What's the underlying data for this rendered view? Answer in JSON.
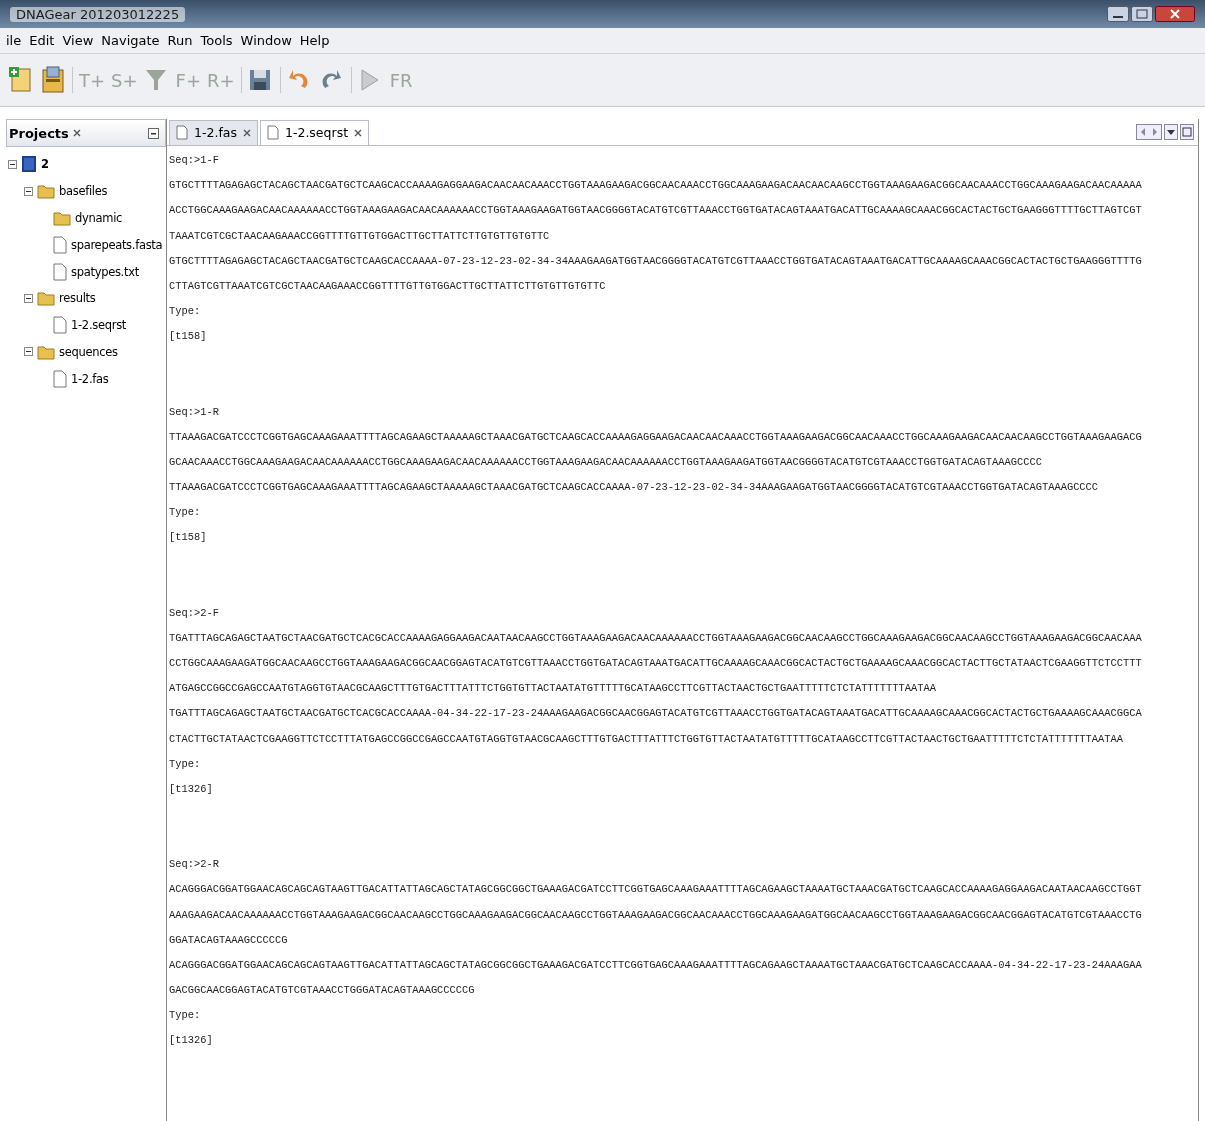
{
  "window": {
    "title": "DNAGear 201203012225"
  },
  "menu": [
    "ile",
    "Edit",
    "View",
    "Navigate",
    "Run",
    "Tools",
    "Window",
    "Help"
  ],
  "toolbar": [
    {
      "kind": "new"
    },
    {
      "kind": "open"
    },
    {
      "kind": "text",
      "label": "T+"
    },
    {
      "kind": "text",
      "label": "S+"
    },
    {
      "kind": "filter"
    },
    {
      "kind": "text",
      "label": "F+"
    },
    {
      "kind": "text",
      "label": "R+"
    },
    {
      "kind": "save"
    },
    {
      "kind": "undo"
    },
    {
      "kind": "redo"
    },
    {
      "kind": "run"
    },
    {
      "kind": "text",
      "label": "FR"
    }
  ],
  "projects": {
    "title": "Projects",
    "tree": [
      {
        "label": "2",
        "kind": "project",
        "expanded": true,
        "children": [
          {
            "label": "basefiles",
            "kind": "folder",
            "expanded": true,
            "children": [
              {
                "label": "dynamic",
                "kind": "folder"
              },
              {
                "label": "sparepeats.fasta",
                "kind": "file"
              },
              {
                "label": "spatypes.txt",
                "kind": "file"
              }
            ]
          },
          {
            "label": "results",
            "kind": "folder",
            "expanded": true,
            "children": [
              {
                "label": "1-2.seqrst",
                "kind": "file"
              }
            ]
          },
          {
            "label": "sequences",
            "kind": "folder",
            "expanded": true,
            "children": [
              {
                "label": "1-2.fas",
                "kind": "file"
              }
            ]
          }
        ]
      }
    ]
  },
  "editor": {
    "tabs": [
      {
        "label": "1-2.fas",
        "selected": false
      },
      {
        "label": "1-2.seqrst",
        "selected": true
      }
    ],
    "records": [
      {
        "header": "Seq:>1-F",
        "sequence_lines": [
          "GTGCTTTTAGAGAGCTACAGCTAACGATGCTCAAGCACCAAAAGAGGAAGACAACAACAAACCTGGTAAAGAAGACGGCAACAAACCTGGCAAAGAAGACAACAACAAGCCTGGTAAAGAAGACGGCAACAAACCTGGCAAAGAAGACAACAAAAA",
          "ACCTGGCAAAGAAGACAACAAAAAACCTGGTAAAGAAGACAACAAAAAACCTGGTAAAGAAGATGGTAACGGGGTACATGTCGTTAAACCTGGTGATACAGTAAATGACATTGCAAAAGCAAACGGCACTACTGCTGAAGGGTTTTGCTTAGTCGT",
          "TAAATCGTCGCTAACAAGAAACCGGTTTTGTTGTGGACTTGCTTATTCTTGTGTTGTGTTC",
          "GTGCTTTTAGAGAGCTACAGCTAACGATGCTCAAGCACCAAAA-07-23-12-23-02-34-34AAAGAAGATGGTAACGGGGTACATGTCGTTAAACCTGGTGATACAGTAAATGACATTGCAAAAGCAAACGGCACTACTGCTGAAGGGTTTTG",
          "CTTAGTCGTTAAATCGTCGCTAACAAGAAACCGGTTTTGTTGTGGACTTGCTTATTCTTGTGTTGTGTTC"
        ],
        "type_label": "Type:",
        "type_value": "[t158]"
      },
      {
        "header": "Seq:>1-R",
        "sequence_lines": [
          "TTAAAGACGATCCCTCGGTGAGCAAAGAAATTTTAGCAGAAGCTAAAAAGCTAAACGATGCTCAAGCACCAAAAGAGGAAGACAACAACAAACCTGGTAAAGAAGACGGCAACAAACCTGGCAAAGAAGACAACAACAAGCCTGGTAAAGAAGACG",
          "GCAACAAACCTGGCAAAGAAGACAACAAAAAACCTGGCAAAGAAGACAACAAAAAACCTGGTAAAGAAGACAACAAAAAACCTGGTAAAGAAGATGGTAACGGGGTACATGTCGTAAACCTGGTGATACAGTAAAGCCCC",
          "TTAAAGACGATCCCTCGGTGAGCAAAGAAATTTTAGCAGAAGCTAAAAAGCTAAACGATGCTCAAGCACCAAAA-07-23-12-23-02-34-34AAAGAAGATGGTAACGGGGTACATGTCGTAAACCTGGTGATACAGTAAAGCCCC"
        ],
        "type_label": "Type:",
        "type_value": "[t158]"
      },
      {
        "header": "Seq:>2-F",
        "sequence_lines": [
          "TGATTTAGCAGAGCTAATGCTAACGATGCTCACGCACCAAAAGAGGAAGACAATAACAAGCCTGGTAAAGAAGACAACAAAAAACCTGGTAAAGAAGACGGCAACAAGCCTGGCAAAGAAGACGGCAACAAGCCTGGTAAAGAAGACGGCAACAAA",
          "CCTGGCAAAGAAGATGGCAACAAGCCTGGTAAAGAAGACGGCAACGGAGTACATGTCGTTAAACCTGGTGATACAGTAAATGACATTGCAAAAGCAAACGGCACTACTGCTGAAAAGCAAACGGCACTACTTGCTATAACTCGAAGGTTCTCCTTT",
          "ATGAGCCGGCCGAGCCAATGTAGGTGTAACGCAAGCTTTGTGACTTTATTTCTGGTGTTACTAATATGTTTTTGCATAAGCCTTCGTTACTAACTGCTGAATTTTTCTCTATTTTTTTAATAA",
          "TGATTTAGCAGAGCTAATGCTAACGATGCTCACGCACCAAAA-04-34-22-17-23-24AAAGAAGACGGCAACGGAGTACATGTCGTTAAACCTGGTGATACAGTAAATGACATTGCAAAAGCAAACGGCACTACTGCTGAAAAGCAAACGGCA",
          "CTACTTGCTATAACTCGAAGGTTCTCCTTTATGAGCCGGCCGAGCCAATGTAGGTGTAACGCAAGCTTTGTGACTTTATTTCTGGTGTTACTAATATGTTTTTGCATAAGCCTTCGTTACTAACTGCTGAATTTTTCTCTATTTTTTTAATAA"
        ],
        "type_label": "Type:",
        "type_value": "[t1326]"
      },
      {
        "header": "Seq:>2-R",
        "sequence_lines": [
          "ACAGGGACGGATGGAACAGCAGCAGTAAGTTGACATTATTAGCAGCTATAGCGGCGGCTGAAAGACGATCCTTCGGTGAGCAAAGAAATTTTAGCAGAAGCTAAAATGCTAAACGATGCTCAAGCACCAAAAGAGGAAGACAATAACAAGCCTGGT",
          "AAAGAAGACAACAAAAAACCTGGTAAAGAAGACGGCAACAAGCCTGGCAAAGAAGACGGCAACAAGCCTGGTAAAGAAGACGGCAACAAACCTGGCAAAGAAGATGGCAACAAGCCTGGTAAAGAAGACGGCAACGGAGTACATGTCGTAAACCTG",
          "GGATACAGTAAAGCCCCCG",
          "ACAGGGACGGATGGAACAGCAGCAGTAAGTTGACATTATTAGCAGCTATAGCGGCGGCTGAAAGACGATCCTTCGGTGAGCAAAGAAATTTTAGCAGAAGCTAAAATGCTAAACGATGCTCAAGCACCAAAA-04-34-22-17-23-24AAAGAA",
          "GACGGCAACGGAGTACATGTCGTAAACCTGGGATACAGTAAAGCCCCCG"
        ],
        "type_label": "Type:",
        "type_value": "[t1326]"
      }
    ]
  }
}
